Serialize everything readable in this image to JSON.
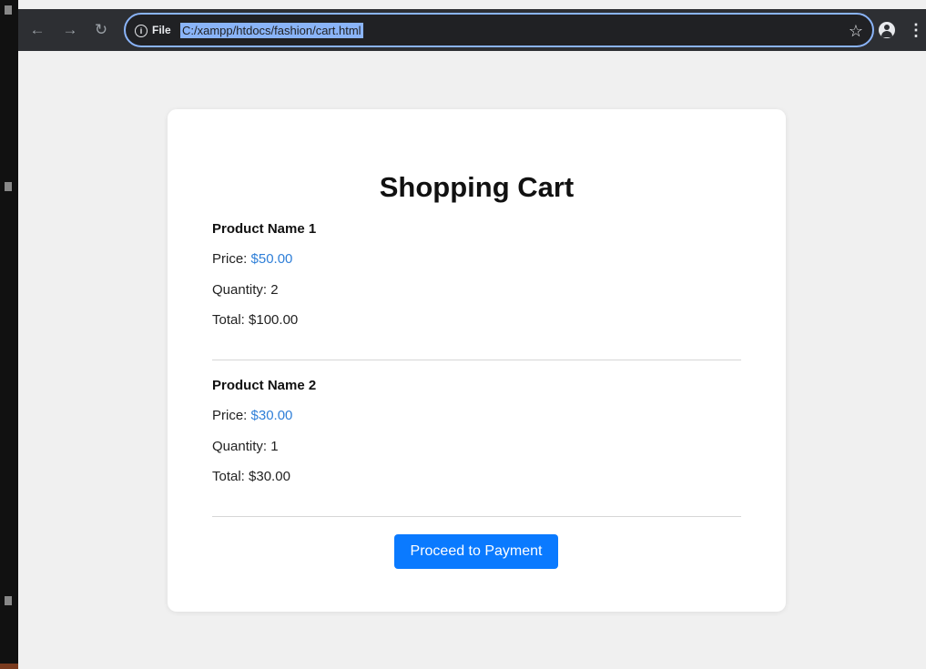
{
  "browser": {
    "nav": {
      "back_icon": "arrow-left-icon",
      "forward_icon": "arrow-right-icon",
      "reload_icon": "reload-icon"
    },
    "address_bar": {
      "scheme_label": "File",
      "url": "C:/xampp/htdocs/fashion/cart.html"
    }
  },
  "cart": {
    "title": "Shopping Cart",
    "items": [
      {
        "name": "Product Name 1",
        "price_label": "Price:",
        "price": "$50.00",
        "quantity_label": "Quantity:",
        "quantity": "2",
        "total_label": "Total:",
        "total": "$100.00"
      },
      {
        "name": "Product Name 2",
        "price_label": "Price:",
        "price": "$30.00",
        "quantity_label": "Quantity:",
        "quantity": "1",
        "total_label": "Total:",
        "total": "$30.00"
      }
    ],
    "pay_button_label": "Proceed to Payment"
  },
  "colors": {
    "accent": "#0a7aff",
    "price": "#2f7fd8",
    "page_bg": "#f0f0f0",
    "card_bg": "#ffffff"
  }
}
